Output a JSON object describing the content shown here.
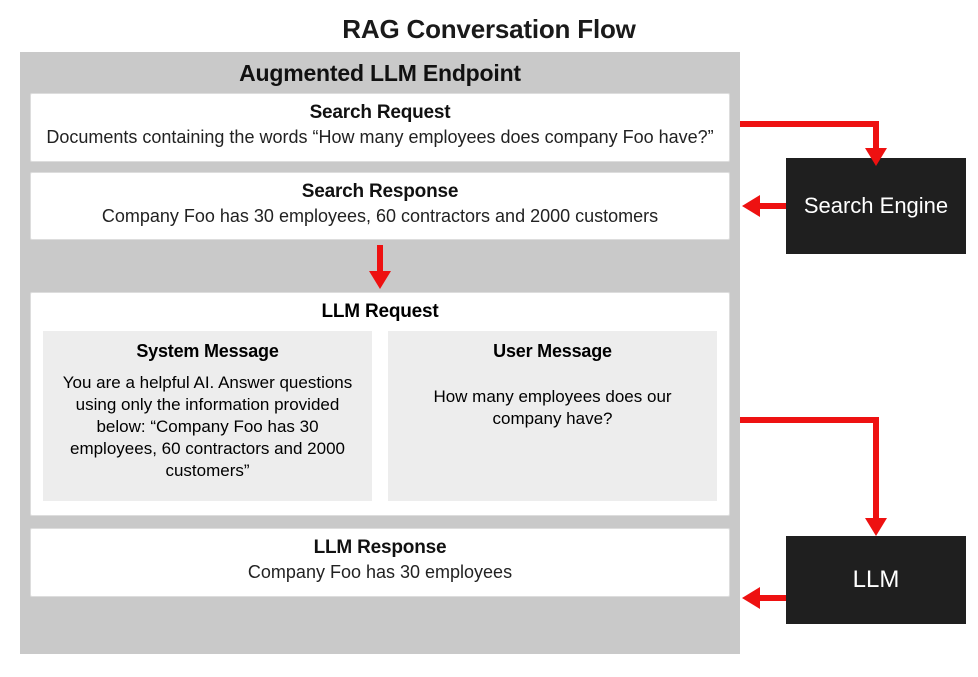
{
  "title": "RAG Conversation Flow",
  "endpoint_title": "Augmented LLM Endpoint",
  "search_request": {
    "title": "Search Request",
    "body": "Documents containing the words “How many employees does company Foo have?”"
  },
  "search_response": {
    "title": "Search Response",
    "body": "Company Foo has 30 employees, 60 contractors and 2000 customers"
  },
  "llm_request": {
    "title": "LLM Request",
    "system": {
      "title": "System Message",
      "body": "You are a helpful AI. Answer questions using only the information provided below: “Company Foo has 30 employees, 60 contractors and 2000 customers”"
    },
    "user": {
      "title": "User Message",
      "body": "How many employees does our company have?"
    }
  },
  "llm_response": {
    "title": "LLM Response",
    "body": "Company Foo has 30 employees"
  },
  "search_engine_label": "Search Engine",
  "llm_label": "LLM"
}
